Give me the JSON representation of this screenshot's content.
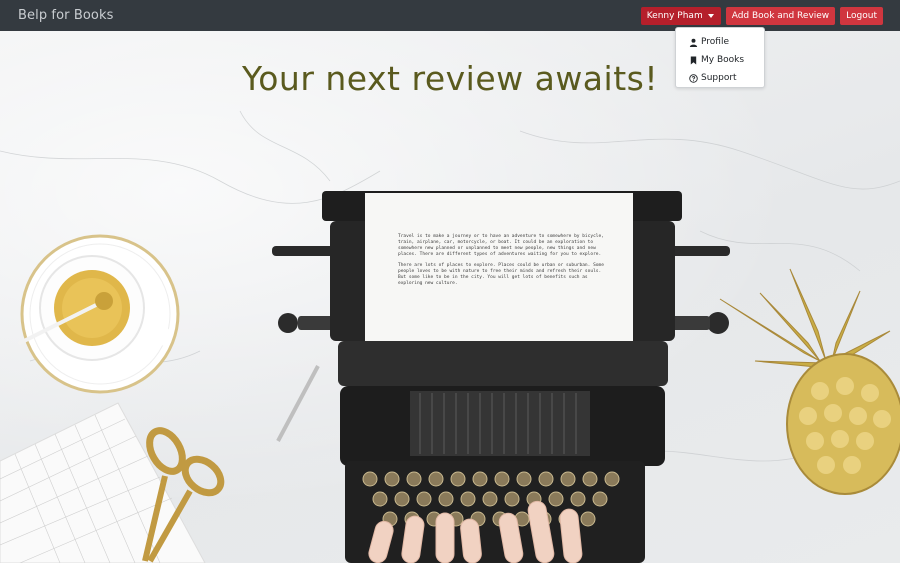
{
  "navbar": {
    "brand": "Belp for Books",
    "user_menu_label": "Kenny Pham",
    "add_button_label": "Add Book and Review",
    "logout_label": "Logout",
    "accent_color": "#d0363f"
  },
  "dropdown": {
    "items": [
      {
        "label": "Profile",
        "icon": "person-icon"
      },
      {
        "label": "My Books",
        "icon": "bookmark-icon"
      },
      {
        "label": "Support",
        "icon": "question-circle-icon"
      }
    ]
  },
  "hero": {
    "headline": "Your next review awaits!",
    "paper_paragraphs": [
      "Travel is to make a journey or to have an adventure to somewhere by bicycle, train, airplane, car, motorcycle, or boat. It could be an exploration to somewhere new planned or unplanned to meet new people, new things and new places. There are different types of adventures waiting for you to explore.",
      "There are lots of places to explore. Places could be urban or suburban. Some people loves to be with nature to free their minds and refresh their souls. But some like to be in the city. You will get lots of benefits such as exploring new culture."
    ]
  }
}
